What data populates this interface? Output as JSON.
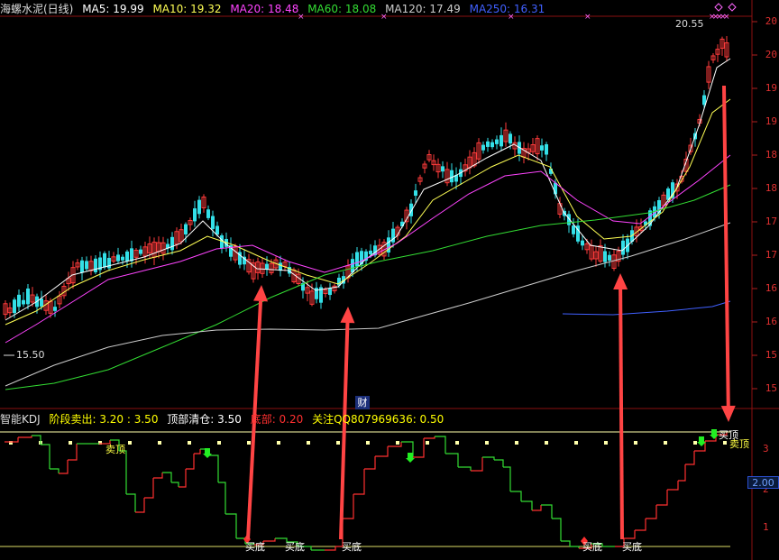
{
  "header": {
    "title": "海螺水泥(日线)",
    "ma": [
      {
        "label": "MA5: 19.99",
        "color": "#ffffff"
      },
      {
        "label": "MA10: 19.32",
        "color": "#ffff55"
      },
      {
        "label": "MA20: 18.48",
        "color": "#ff44ff"
      },
      {
        "label": "MA60: 18.08",
        "color": "#33dd33"
      },
      {
        "label": "MA120: 17.49",
        "color": "#cccccc"
      },
      {
        "label": "MA250: 16.31",
        "color": "#4060ff"
      }
    ]
  },
  "price_axis": [
    "20",
    "20",
    "19",
    "19",
    "18",
    "18",
    "17",
    "17",
    "16",
    "16",
    "15",
    "15"
  ],
  "price_labels": {
    "high": "20.55",
    "low": "15.50"
  },
  "indicator": {
    "title": "智能KDJ",
    "items": [
      {
        "label": "阶段卖出: 3.20 : 3.50",
        "color": "#ffff00"
      },
      {
        "label": "顶部清仓: 3.50",
        "color": "#ffffff"
      },
      {
        "label": "底部: 0.20",
        "color": "#ff3030"
      },
      {
        "label": "关注QQ807969636: 0.50",
        "color": "#ffff00"
      }
    ],
    "axis": [
      "3",
      "2",
      "1"
    ],
    "level_badge": "2.00",
    "fin_badge": "财",
    "signals": {
      "sell_top_left": "卖顶",
      "buy_bottom": "买底",
      "sell_top_right": "卖顶",
      "buy_top": "买顶"
    }
  },
  "colors": {
    "up": "#ff3b3b",
    "down": "#33e0e8",
    "kdj_up": "#ff3030",
    "kdj_down": "#33dd33",
    "arrow": "#ff4444"
  }
}
